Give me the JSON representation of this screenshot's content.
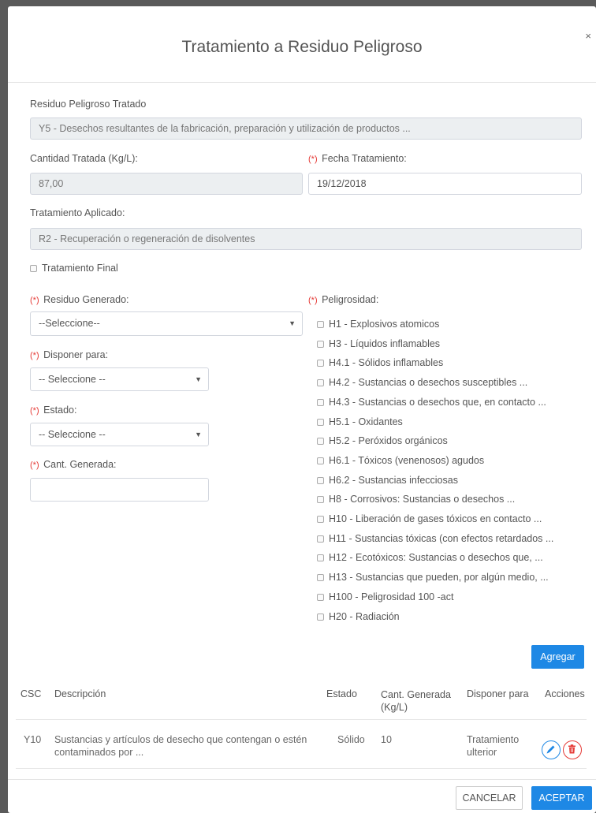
{
  "modal": {
    "title": "Tratamiento a Residuo Peligroso",
    "close_symbol": "×"
  },
  "form": {
    "residuo_tratado_label": "Residuo Peligroso Tratado",
    "residuo_tratado_value": "Y5 -  Desechos resultantes de la fabricación, preparación y utilización de productos ...",
    "cantidad_label": "Cantidad Tratada (Kg/L):",
    "cantidad_value": "87,00",
    "required_mark": "(*)",
    "fecha_label": "Fecha Tratamiento:",
    "fecha_value": "19/12/2018",
    "tratamiento_label": "Tratamiento Aplicado:",
    "tratamiento_value": "R2 - Recuperación o regeneración de disolventes",
    "tratamiento_final_label": "Tratamiento Final",
    "tratamiento_final_checked": false,
    "residuo_generado_label": "Residuo Generado:",
    "residuo_generado_value": "--Seleccione--",
    "disponer_label": "Disponer para:",
    "disponer_value": "-- Seleccione --",
    "estado_label": "Estado:",
    "estado_value": "-- Seleccione --",
    "cant_generada_label": "Cant. Generada:",
    "cant_generada_value": "",
    "peligrosidad_label": "Peligrosidad:"
  },
  "peligrosidad": [
    {
      "label": "H1 - Explosivos atomicos",
      "checked": false
    },
    {
      "label": "H3 - Líquidos inflamables",
      "checked": false
    },
    {
      "label": "H4.1 - Sólidos inflamables",
      "checked": false
    },
    {
      "label": "H4.2 - Sustancias o desechos susceptibles ...",
      "checked": false
    },
    {
      "label": "H4.3 - Sustancias o desechos que, en contacto ...",
      "checked": false
    },
    {
      "label": "H5.1 - Oxidantes",
      "checked": false
    },
    {
      "label": "H5.2 - Peróxidos orgánicos",
      "checked": false
    },
    {
      "label": "H6.1 - Tóxicos (venenosos) agudos",
      "checked": false
    },
    {
      "label": "H6.2 - Sustancias infecciosas",
      "checked": false
    },
    {
      "label": "H8 - Corrosivos: Sustancias o desechos ...",
      "checked": false
    },
    {
      "label": "H10 - Liberación de gases tóxicos en contacto ...",
      "checked": false
    },
    {
      "label": "H11 - Sustancias tóxicas (con efectos retardados ...",
      "checked": false
    },
    {
      "label": "H12 - Ecotóxicos: Sustancias o desechos que, ...",
      "checked": false
    },
    {
      "label": "H13 - Sustancias que pueden, por algún medio, ...",
      "checked": false
    },
    {
      "label": "H100 - Peligrosidad 100 -act",
      "checked": false
    },
    {
      "label": "H20 - Radiación",
      "checked": false
    }
  ],
  "buttons": {
    "agregar": "Agregar",
    "cancelar": "CANCELAR",
    "aceptar": "ACEPTAR"
  },
  "table": {
    "headers": {
      "csc": "CSC",
      "descripcion": "Descripción",
      "estado": "Estado",
      "cant_line1": "Cant. Generada",
      "cant_line2": "(Kg/L)",
      "disponer": "Disponer para",
      "acciones": "Acciones"
    },
    "rows": [
      {
        "csc": "Y10",
        "descripcion_line1": "Sustancias y artículos de desecho que contengan o estén",
        "descripcion_line2": "contaminados por ...",
        "estado": "Sólido",
        "cant": "10",
        "disponer_line1": "Tratamiento",
        "disponer_line2": "ulterior"
      }
    ]
  },
  "colors": {
    "primary": "#1e88e5",
    "danger": "#e53935",
    "readonly_bg": "#eceff1"
  },
  "icons": {
    "edit": "pencil-icon",
    "delete": "trash-icon",
    "dropdown": "caret-down-icon"
  }
}
